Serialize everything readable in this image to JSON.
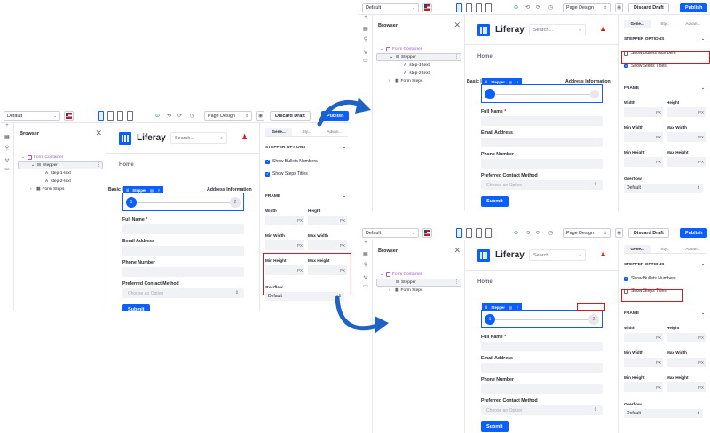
{
  "toolbar": {
    "experience": "Default",
    "page_design": "Page Design",
    "discard": "Discard Draft",
    "publish": "Publish",
    "chevron": "⌄",
    "undo": "⟲",
    "redo": "⟳",
    "history": "◷",
    "preview": "◉",
    "check": "⊙",
    "flag": "us-flag-icon"
  },
  "rail": {
    "icons": [
      "plus-icon",
      "browser-icon",
      "paint-icon",
      "link-icon",
      "comment-icon"
    ]
  },
  "browser": {
    "title": "Browser",
    "close": "✕",
    "tree": [
      {
        "label": "Form Container",
        "kind": "container",
        "depth": 0,
        "expander": "⌄"
      },
      {
        "label": "Stepper",
        "kind": "stepper",
        "depth": 1,
        "expander": "⌄",
        "menu": "⋮",
        "selected": true
      },
      {
        "label": "step-1-text",
        "kind": "text",
        "depth": 2,
        "glyph": "A"
      },
      {
        "label": "step-2-text",
        "kind": "text",
        "depth": 2,
        "glyph": "A"
      },
      {
        "label": "Form Steps",
        "kind": "steps",
        "depth": 1,
        "expander": "›"
      }
    ],
    "tree_collapsed": [
      {
        "label": "Form Container",
        "kind": "container",
        "depth": 0,
        "expander": "⌄"
      },
      {
        "label": "Stepper",
        "kind": "stepper",
        "depth": 1,
        "expander": "",
        "menu": "⋮",
        "selected": true
      },
      {
        "label": "Form Steps",
        "kind": "steps",
        "depth": 1,
        "expander": "›"
      }
    ]
  },
  "site": {
    "brand": "Liferay",
    "search_placeholder": "Search...",
    "search_icon": "⌕",
    "user_icon": "♟",
    "home": "Home"
  },
  "stepper": {
    "tag": "Stepper",
    "step1": "Basic Information",
    "step2": "Address Information",
    "n1": "1",
    "n2": "2"
  },
  "form": {
    "fields": [
      {
        "label": "Full Name",
        "required": true,
        "value": ""
      },
      {
        "label": "Email Address",
        "required": false,
        "value": ""
      },
      {
        "label": "Phone Number",
        "required": false,
        "value": ""
      },
      {
        "label": "Preferred Contact Method",
        "required": false,
        "value": "Choose an Option",
        "select": true
      }
    ],
    "submit": "Submit",
    "required_mark": "*",
    "select_chevron": "⌄"
  },
  "panel": {
    "tabs": [
      "Gene...",
      "Sty...",
      "Advan..."
    ],
    "tabs_alt": [
      "Gene...",
      "Sty...",
      "Advan..."
    ],
    "stepper_options": "STEPPER OPTIONS",
    "show_bullets": "Show Bullets Numbers",
    "show_titles": "Show Steps Titles",
    "frame": "FRAME",
    "width": "Width",
    "height": "Height",
    "min_width": "Min Width",
    "max_width": "Max Width",
    "min_height": "Min Height",
    "max_height": "Max Height",
    "unit": "PX",
    "overflow": "Overflow",
    "overflow_value": "Default",
    "collapse": "⌄",
    "stepper_chev": "⌄"
  },
  "states": {
    "main": {
      "bullets": true,
      "titles": true
    },
    "top_right": {
      "bullets": false,
      "titles": true
    },
    "bottom_right": {
      "bullets": true,
      "titles": false
    }
  },
  "colors": {
    "accent": "#0b5fff",
    "highlight": "#e0141f",
    "arrow": "#1f62c4"
  }
}
